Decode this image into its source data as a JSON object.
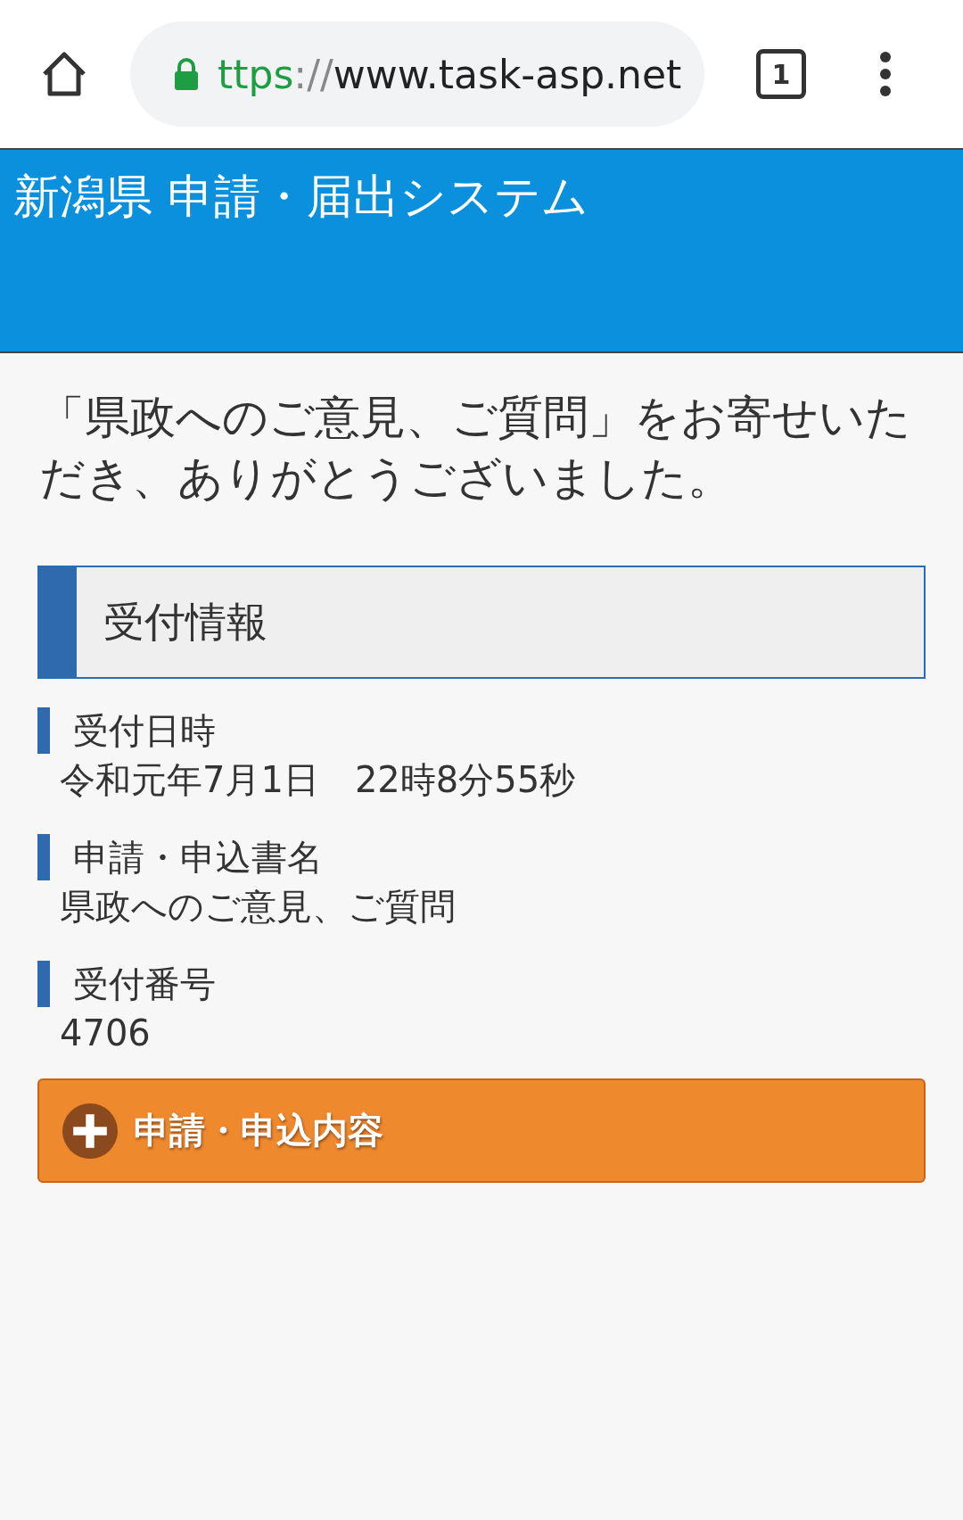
{
  "browser": {
    "url": {
      "scheme": "ttps",
      "separator": "://",
      "host": "www.task-asp.net"
    },
    "tab_count": "1"
  },
  "header": {
    "title": "新潟県 申請・届出システム"
  },
  "message": "「県政へのご意見、ご質問」をお寄せいただき、ありがとうございました。",
  "section": {
    "title": "受付情報"
  },
  "fields": [
    {
      "label": "受付日時",
      "value": "令和元年7月1日　22時8分55秒"
    },
    {
      "label": "申請・申込書名",
      "value": "県政へのご意見、ご質問"
    },
    {
      "label": "受付番号",
      "value": "4706"
    }
  ],
  "expand_button": {
    "label": "申請・申込内容",
    "expanded": false
  }
}
